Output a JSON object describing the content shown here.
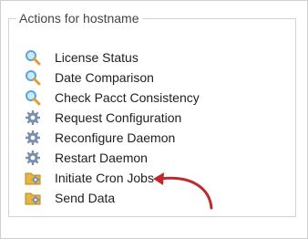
{
  "panel": {
    "title": "Actions for hostname"
  },
  "actions": [
    {
      "label": "License Status",
      "icon": "magnifier-icon"
    },
    {
      "label": "Date Comparison",
      "icon": "magnifier-icon"
    },
    {
      "label": "Check Pacct Consistency",
      "icon": "magnifier-icon"
    },
    {
      "label": "Request Configuration",
      "icon": "gear-icon"
    },
    {
      "label": "Reconfigure Daemon",
      "icon": "gear-icon"
    },
    {
      "label": "Restart Daemon",
      "icon": "gear-icon"
    },
    {
      "label": "Initiate Cron Jobs",
      "icon": "folder-gear-icon"
    },
    {
      "label": "Send Data",
      "icon": "folder-gear-icon"
    }
  ],
  "colors": {
    "annotation_arrow": "#c0282d",
    "magnifier_glass": "#5aa6d8",
    "magnifier_handle": "#e0a030",
    "gear": "#7a8fb0",
    "folder": "#e6b640"
  }
}
